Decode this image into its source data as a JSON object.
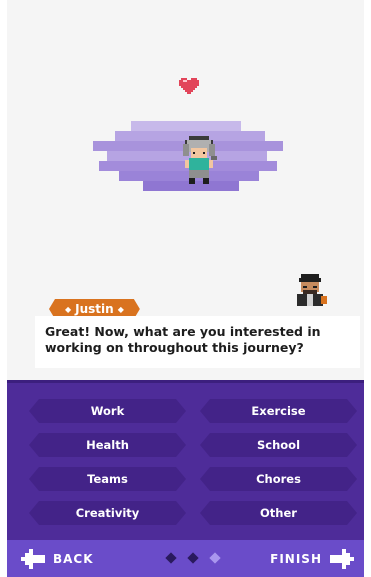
{
  "dialog": {
    "speaker": "Justin",
    "message": "Great! Now, what are you interested in working on throughout this journey?"
  },
  "choices": [
    "Work",
    "Exercise",
    "Health",
    "School",
    "Teams",
    "Chores",
    "Creativity",
    "Other"
  ],
  "nav": {
    "back_label": "BACK",
    "finish_label": "FINISH"
  },
  "progress": {
    "total_steps": 3,
    "active_step": 3
  },
  "colors": {
    "panel": "#4e2c99",
    "choice": "#432388",
    "bottom_bar": "#6a4cc9",
    "speaker_tag": "#d9731f",
    "heart": "#e2455a"
  },
  "icons": {
    "heart": "heart-icon",
    "hero": "hero-sprite",
    "npc": "npc-justin-sprite",
    "back": "arrow-left-icon",
    "finish": "arrow-right-icon"
  }
}
